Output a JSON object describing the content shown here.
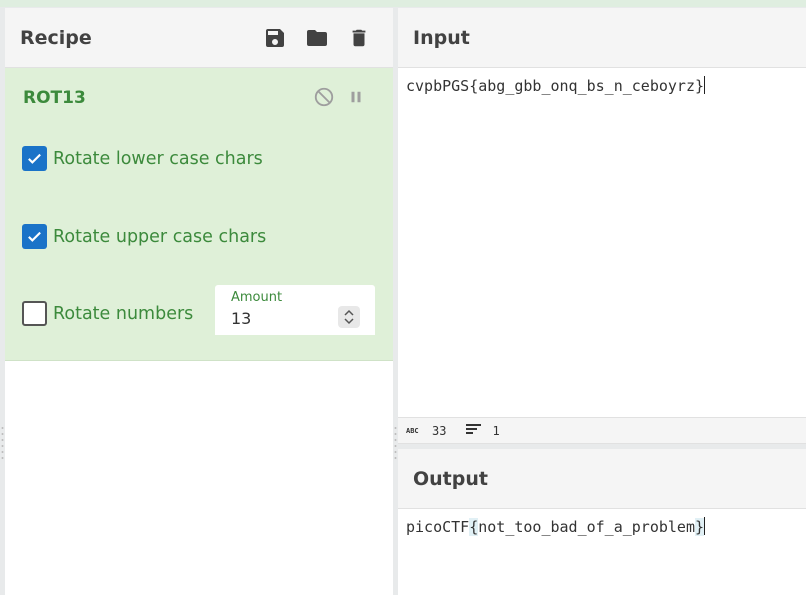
{
  "recipe": {
    "title": "Recipe",
    "icons": [
      "save-icon",
      "folder-icon",
      "trash-icon"
    ]
  },
  "operation": {
    "name": "ROT13",
    "icons": [
      "disable-icon",
      "pause-icon"
    ],
    "options": {
      "rotate_lower": {
        "label": "Rotate lower case chars",
        "checked": true
      },
      "rotate_upper": {
        "label": "Rotate upper case chars",
        "checked": true
      },
      "rotate_numbers": {
        "label": "Rotate numbers",
        "checked": false
      }
    },
    "amount": {
      "label": "Amount",
      "value": "13"
    }
  },
  "input": {
    "title": "Input",
    "text": "cvpbPGS{abg_gbb_onq_bs_n_ceboyrz}"
  },
  "status": {
    "length_icon": "abc-icon",
    "length": "33",
    "lines_icon": "lines-icon",
    "lines": "1"
  },
  "output": {
    "title": "Output",
    "prefix": "picoCTF",
    "open_brace": "{",
    "body": "not_too_bad_of_a_problem",
    "close_brace": "}"
  },
  "colors": {
    "accent_green": "#3c8a3c",
    "operation_bg": "#dff0d8",
    "checkbox_blue": "#1a73c8"
  }
}
